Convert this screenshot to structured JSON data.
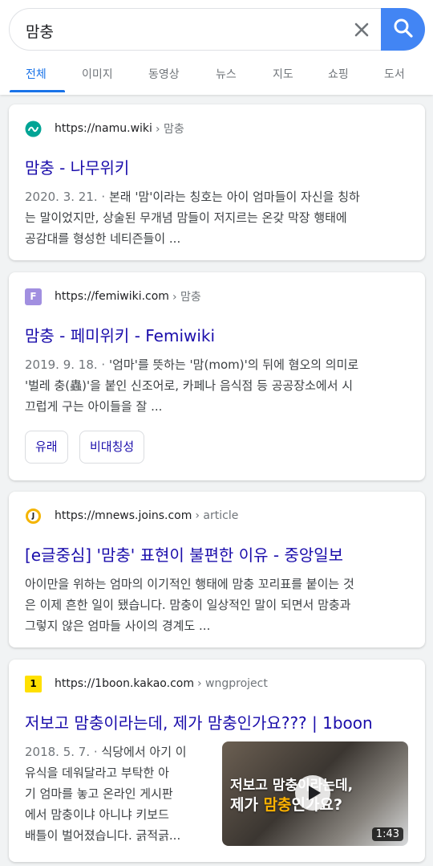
{
  "search": {
    "query": "맘충"
  },
  "tabs": [
    "전체",
    "이미지",
    "동영상",
    "뉴스",
    "지도",
    "쇼핑",
    "도서"
  ],
  "results": [
    {
      "url": "https://namu.wiki",
      "crumb": "› 맘충",
      "title": "맘충 - 나무위키",
      "date": "2020. 3. 21. ·",
      "snippet_lines": [
        "본래 '맘'이라는 칭호는 아이 엄마들이 자신을 칭하",
        "는 말이었지만, 상술된 무개념 맘들이 저지르는 온갖 막장 행태에",
        "공감대를 형성한 네티즌들이 ..."
      ]
    },
    {
      "url": "https://femiwiki.com",
      "crumb": "› 맘충",
      "favicon_letter": "F",
      "title": "맘충 - 페미위키 - Femiwiki",
      "date": "2019. 9. 18. ·",
      "snippet_lines": [
        "'엄마'를 뜻하는 '맘(mom)'의 뒤에 혐오의 의미로",
        "'벌레 충(蟲)'을 붙인 신조어로, 카페나 음식점 등 공공장소에서 시",
        "끄럽게 구는 아이들을 잘 ..."
      ],
      "chips": [
        "유래",
        "비대칭성"
      ]
    },
    {
      "url": "https://mnews.joins.com",
      "crumb": "› article",
      "title": "[e글중심] '맘충' 표현이 불편한 이유 - 중앙일보",
      "snippet_lines": [
        "아이만을 위하는 엄마의 이기적인 행태에 맘충 꼬리표를 붙이는 것",
        "은 이제 흔한 일이 됐습니다. 맘충이 일상적인 말이 되면서 맘충과",
        "그렇지 않은 엄마들 사이의 경계도 ..."
      ]
    },
    {
      "url": "https://1boon.kakao.com",
      "crumb": "› wngproject",
      "favicon_letter": "1",
      "title": "저보고 맘충이라는데, 제가 맘충인가요??? | 1boon",
      "date": "2018. 5. 7. ·",
      "snippet_lines": [
        "식당에서 아기 이",
        "유식을 데워달라고 부탁한 아",
        "기 엄마를 놓고 온라인 게시판",
        "에서 맘충이냐 아니냐 키보드",
        "배틀이 벌어졌습니다. 긁적긁..."
      ],
      "thumbnail": {
        "line1": "저보고 맘충이라는데,",
        "line2_a": "제가 ",
        "line2_b": "맘충",
        "line2_c": "인가요?",
        "duration": "1:43"
      }
    }
  ],
  "colors": {
    "link": "#1a0dab",
    "accent": "#1a73e8",
    "search_button": "#4285f4"
  }
}
